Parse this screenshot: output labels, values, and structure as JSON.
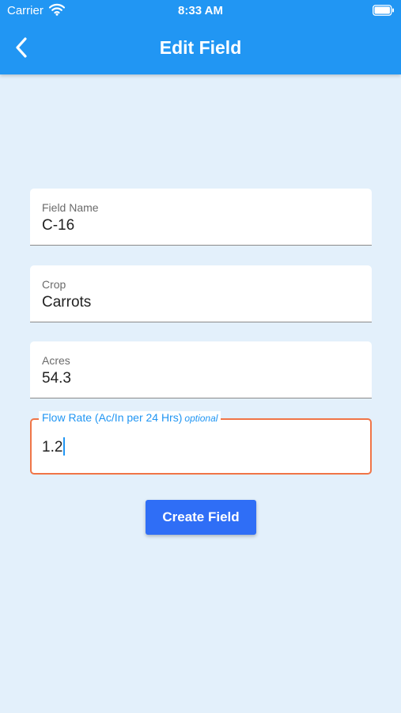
{
  "status_bar": {
    "carrier": "Carrier",
    "time": "8:33 AM",
    "icons": [
      "wifi-icon",
      "battery-icon"
    ]
  },
  "header": {
    "title": "Edit Field",
    "back_icon": "chevron-left-icon",
    "color": "#2196f3"
  },
  "form": {
    "fields": [
      {
        "label": "Field Name",
        "value": "C-16"
      },
      {
        "label": "Crop",
        "value": "Carrots"
      },
      {
        "label": "Acres",
        "value": "54.3"
      },
      {
        "label": "Flow Rate (Ac/In per 24 Hrs)",
        "label_suffix": "optional",
        "value": "1.2",
        "focused": true
      }
    ],
    "submit_label": "Create Field"
  },
  "colors": {
    "background": "#e3f0fb",
    "focus_border": "#f07547",
    "focus_label": "#2196f3",
    "button": "#2f6ef6"
  }
}
